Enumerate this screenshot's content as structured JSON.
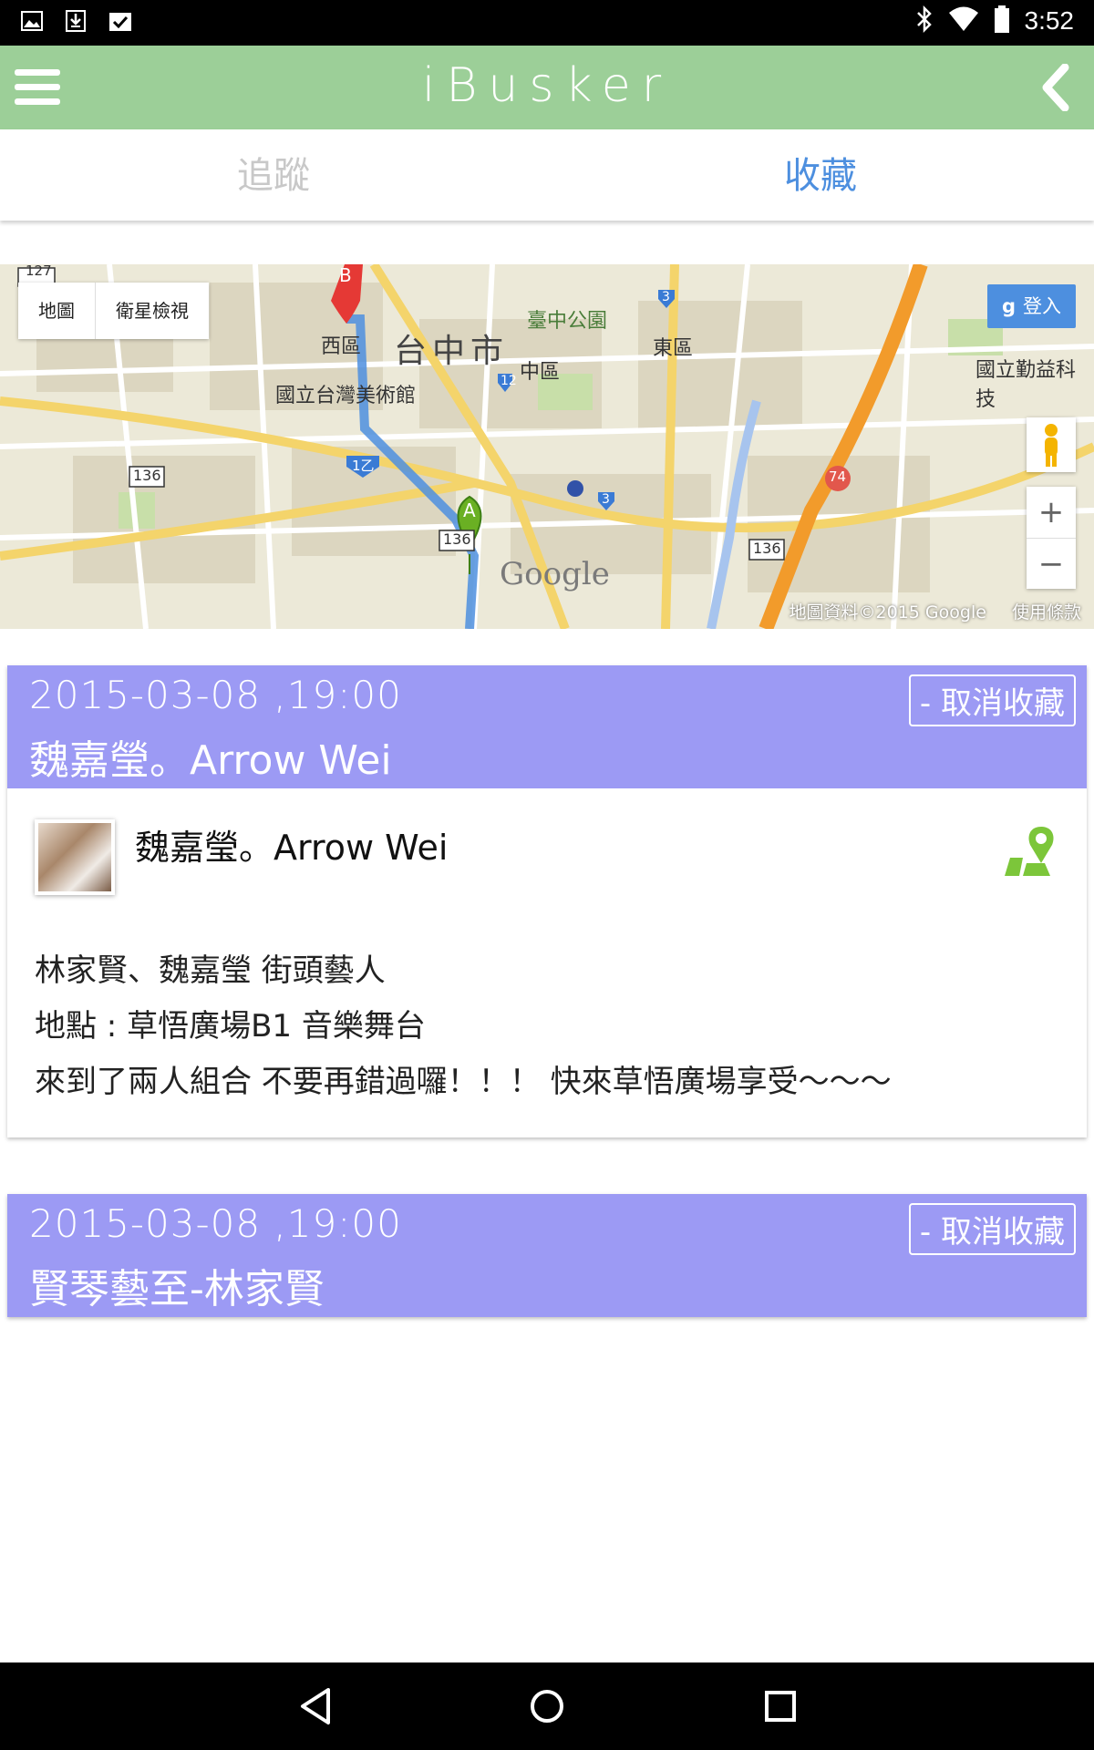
{
  "status_bar": {
    "time": "3:52"
  },
  "header": {
    "title": "iBusker"
  },
  "tabs": [
    {
      "label": "追蹤",
      "active": false
    },
    {
      "label": "收藏",
      "active": true
    }
  ],
  "map": {
    "map_type": [
      "地圖",
      "衛星檢視"
    ],
    "signin_label": "登入",
    "zoom_in": "+",
    "zoom_out": "−",
    "attribution": "地圖資料©2015 Google",
    "terms": "使用條款",
    "google_logo": "Google",
    "labels": {
      "city": "台中市",
      "park": "臺中公園",
      "west": "西區",
      "central": "中區",
      "east": "東區",
      "museum": "國立台灣美術館",
      "university": "國立勤益科技",
      "marker_a": "A",
      "marker_b": "B",
      "shield_12": "12",
      "shield_1": "1乙",
      "shield_3": "3",
      "shield_74": "74",
      "route_136": "136",
      "route_127": "127"
    }
  },
  "events": [
    {
      "datetime": "2015-03-08 ,19:00",
      "name": "魏嘉瑩。Arrow Wei",
      "unfav_label": "- 取消收藏",
      "performer": "魏嘉瑩。Arrow Wei",
      "lines": [
        "林家賢、魏嘉瑩 街頭藝人",
        "地點 : 草悟廣場B1 音樂舞台",
        "來到了兩人組合 不要再錯過囉！！！ 快來草悟廣場享受〜〜〜"
      ]
    },
    {
      "datetime": "2015-03-08 ,19:00",
      "name": "賢琴藝至-林家賢",
      "unfav_label": "- 取消收藏"
    }
  ],
  "colors": {
    "header": "#9ccf98",
    "card_header": "#9c9af4",
    "active_tab": "#4d8fdf",
    "inactive_tab": "#c8c8c8",
    "location_icon": "#7cc63a"
  },
  "icons": {
    "menu": "hamburger-icon",
    "back": "chevron-left-icon",
    "location": "map-location-icon",
    "nav_back": "triangle-back-icon",
    "nav_home": "circle-home-icon",
    "nav_recents": "square-recents-icon"
  }
}
